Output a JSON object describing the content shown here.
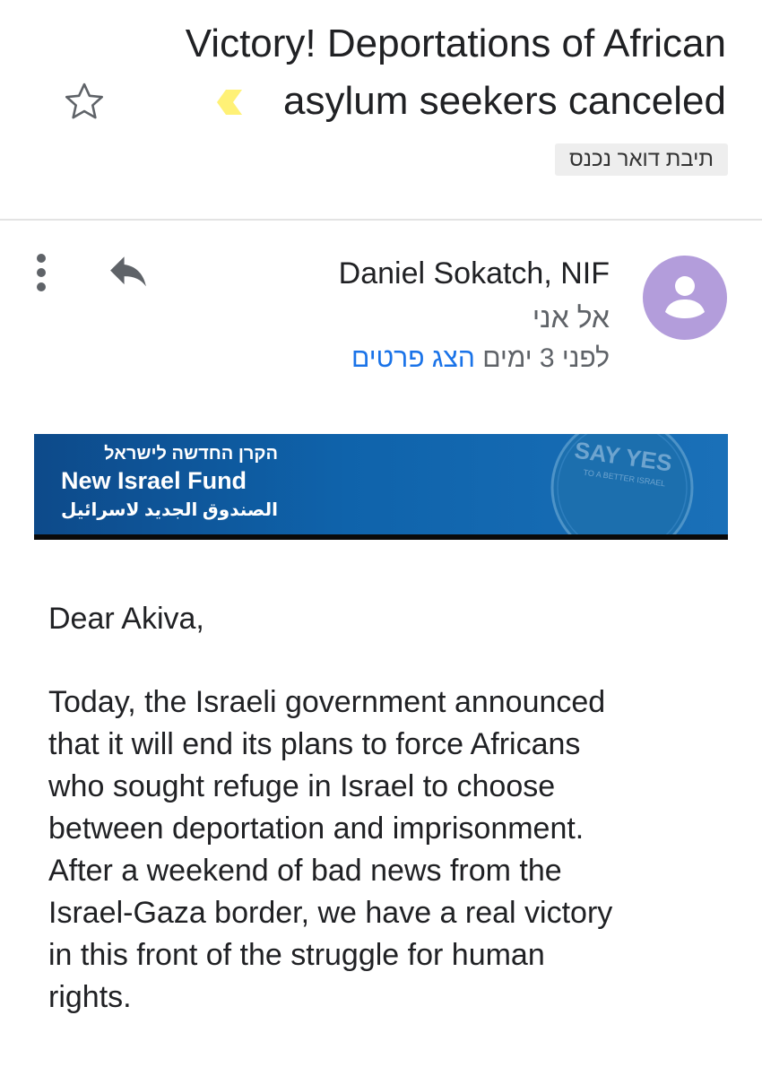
{
  "email": {
    "subject_line1": "Victory! Deportations of African",
    "subject_line2": "asylum seekers canceled",
    "label": "תיבת דואר נכנס",
    "sender_name": "Daniel Sokatch, NIF",
    "recipient": "אל אני",
    "time": "לפני 3 ימים",
    "details_link": "הצג פרטים"
  },
  "banner": {
    "hebrew": "הקרן החדשה לישראל",
    "english": "New Israel Fund",
    "arabic": "الصندوق الجديد لاسرائيل",
    "seal_main": "SAY YES",
    "seal_sub": "TO A BETTER ISRAEL",
    "color": "#0f63ab"
  },
  "body": {
    "greeting": "Dear Akiva,",
    "paragraph_lines": [
      "Today, the Israeli government announced",
      "that it will end its plans to force Africans",
      "who sought refuge in Israel to choose",
      "between deportation and imprisonment.",
      "After a weekend of bad news from the",
      "Israel-Gaza border, we have a real victory",
      "in this front of the struggle for human",
      "rights."
    ]
  },
  "colors": {
    "avatar": "#b39ddb",
    "link": "#1a73e8",
    "importance": "#fff176"
  },
  "icons": [
    "star-icon",
    "importance-marker-icon",
    "more-vert-icon",
    "reply-icon",
    "person-icon"
  ]
}
